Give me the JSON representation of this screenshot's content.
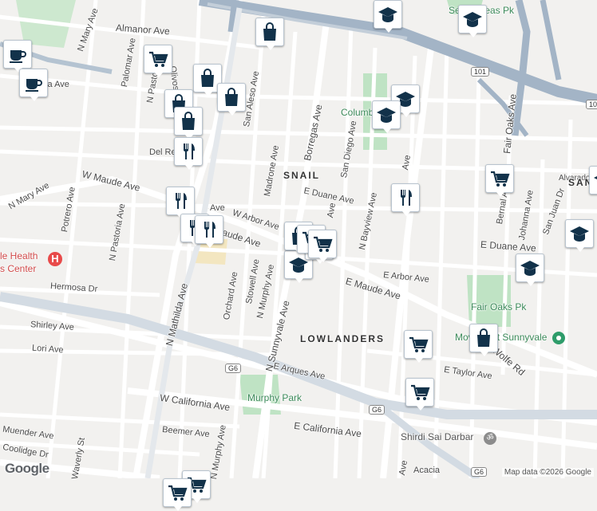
{
  "map": {
    "street_labels": [
      {
        "text": "Almanor Ave"
      },
      {
        "text": "N Mary Ave"
      },
      {
        "text": "Palomar Ave"
      },
      {
        "text": "N Pastoria Ave"
      },
      {
        "text": "Olivos Ave"
      },
      {
        "text": "San Aleso Ave"
      },
      {
        "text": "Borregas Ave"
      },
      {
        "text": "San Diego Ave"
      },
      {
        "text": "Madrone Ave"
      },
      {
        "text": "Del Rey Ave"
      },
      {
        "text": "W Maude Ave"
      },
      {
        "text": "Potrero Ave"
      },
      {
        "text": "N Pastoria Ave"
      },
      {
        "text": "E Duane Ave"
      },
      {
        "text": "W Arbor Ave"
      },
      {
        "text": "Maude Ave"
      },
      {
        "text": "Orchard Ave"
      },
      {
        "text": "Stowell Ave"
      },
      {
        "text": "N Murphy Ave"
      },
      {
        "text": "N Sunnyvale Ave"
      },
      {
        "text": "N Bayview Ave"
      },
      {
        "text": "E Maude Ave"
      },
      {
        "text": "E Arbor Ave"
      },
      {
        "text": "E Duane Ave"
      },
      {
        "text": "Bernal Ave"
      },
      {
        "text": "Johanna Ave"
      },
      {
        "text": "San Juan Dr"
      },
      {
        "text": "Fair Oaks Ave"
      },
      {
        "text": "Alvarado"
      },
      {
        "text": "Hermosa Dr"
      },
      {
        "text": "N Mathilda Ave"
      },
      {
        "text": "Shirley Ave"
      },
      {
        "text": "Lori Ave"
      },
      {
        "text": "E Arques Ave"
      },
      {
        "text": "E Taylor Ave"
      },
      {
        "text": "W California Ave"
      },
      {
        "text": "E California Ave"
      },
      {
        "text": "Beemer Ave"
      },
      {
        "text": "Muender Ave"
      },
      {
        "text": "Coolidge Dr"
      },
      {
        "text": "Waverly St"
      },
      {
        "text": "N Murphy Ave"
      },
      {
        "text": "Acacia"
      },
      {
        "text": "N Wolfe Rd"
      },
      {
        "text": "Ave"
      },
      {
        "text": "Ave"
      },
      {
        "text": "Pericia Ave"
      },
      {
        "text": "Ave"
      },
      {
        "text": "Ave"
      }
    ],
    "area_labels": [
      {
        "text": "SNAIL"
      },
      {
        "text": "LOWLANDERS"
      },
      {
        "text": "SAN"
      }
    ],
    "poi_labels": [
      {
        "text": "Columbia"
      },
      {
        "text": "Seven Seas Pk"
      },
      {
        "text": "Fair Oaks Pk"
      },
      {
        "text": "Movement Sunnyvale"
      },
      {
        "text": "Murphy Park"
      },
      {
        "text": "Shirdi Sai Darbar"
      },
      {
        "text": "le Health"
      },
      {
        "text": "s Center"
      }
    ],
    "highway_shields": [
      {
        "text": "101"
      },
      {
        "text": "101"
      },
      {
        "text": "G6"
      },
      {
        "text": "G6"
      },
      {
        "text": "G6"
      }
    ],
    "markers": [
      {
        "type": "coffee"
      },
      {
        "type": "coffee"
      },
      {
        "type": "grocery"
      },
      {
        "type": "shopping"
      },
      {
        "type": "shopping"
      },
      {
        "type": "shopping"
      },
      {
        "type": "shopping"
      },
      {
        "type": "shopping"
      },
      {
        "type": "restaurant"
      },
      {
        "type": "restaurant"
      },
      {
        "type": "restaurant"
      },
      {
        "type": "restaurant"
      },
      {
        "type": "restaurant"
      },
      {
        "type": "school"
      },
      {
        "type": "school"
      },
      {
        "type": "school"
      },
      {
        "type": "school"
      },
      {
        "type": "school"
      },
      {
        "type": "school"
      },
      {
        "type": "school"
      },
      {
        "type": "school"
      },
      {
        "type": "grocery"
      },
      {
        "type": "grocery"
      },
      {
        "type": "grocery"
      },
      {
        "type": "grocery"
      },
      {
        "type": "grocery"
      },
      {
        "type": "grocery"
      },
      {
        "type": "shopping"
      },
      {
        "type": "shopping"
      },
      {
        "type": "grocery"
      },
      {
        "type": "grocery"
      }
    ],
    "colors": {
      "land": "#f2f1ef",
      "road": "#ffffff",
      "highway": "#a3b4c6",
      "park": "#bfe3c4",
      "marker_icon": "#12324a"
    }
  },
  "attribution": "Map data ©2026 Google",
  "logo": "Google",
  "hospital_symbol": "H",
  "temple_symbol": "ॐ"
}
